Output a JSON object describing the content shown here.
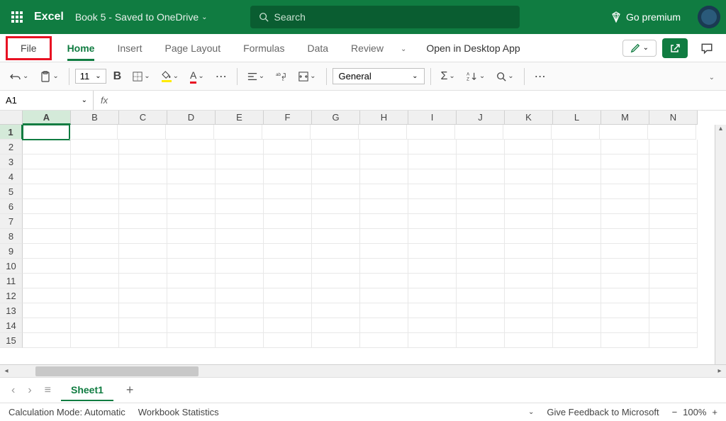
{
  "title_bar": {
    "app_name": "Excel",
    "doc_title": "Book 5 - Saved to OneDrive",
    "search_placeholder": "Search",
    "premium_label": "Go premium"
  },
  "tabs": {
    "file": "File",
    "home": "Home",
    "insert": "Insert",
    "page_layout": "Page Layout",
    "formulas": "Formulas",
    "data": "Data",
    "review": "Review",
    "desktop_app": "Open in Desktop App"
  },
  "toolbar": {
    "font_size": "11",
    "number_format": "General"
  },
  "name_box": {
    "cell_ref": "A1",
    "fx": "fx"
  },
  "columns": [
    "A",
    "B",
    "C",
    "D",
    "E",
    "F",
    "G",
    "H",
    "I",
    "J",
    "K",
    "L",
    "M",
    "N"
  ],
  "rows": [
    "1",
    "2",
    "3",
    "4",
    "5",
    "6",
    "7",
    "8",
    "9",
    "10",
    "11",
    "12",
    "13",
    "14",
    "15"
  ],
  "sheet_tabs": {
    "sheet1": "Sheet1"
  },
  "status_bar": {
    "calc_mode": "Calculation Mode: Automatic",
    "workbook_stats": "Workbook Statistics",
    "feedback": "Give Feedback to Microsoft",
    "zoom": "100%"
  }
}
